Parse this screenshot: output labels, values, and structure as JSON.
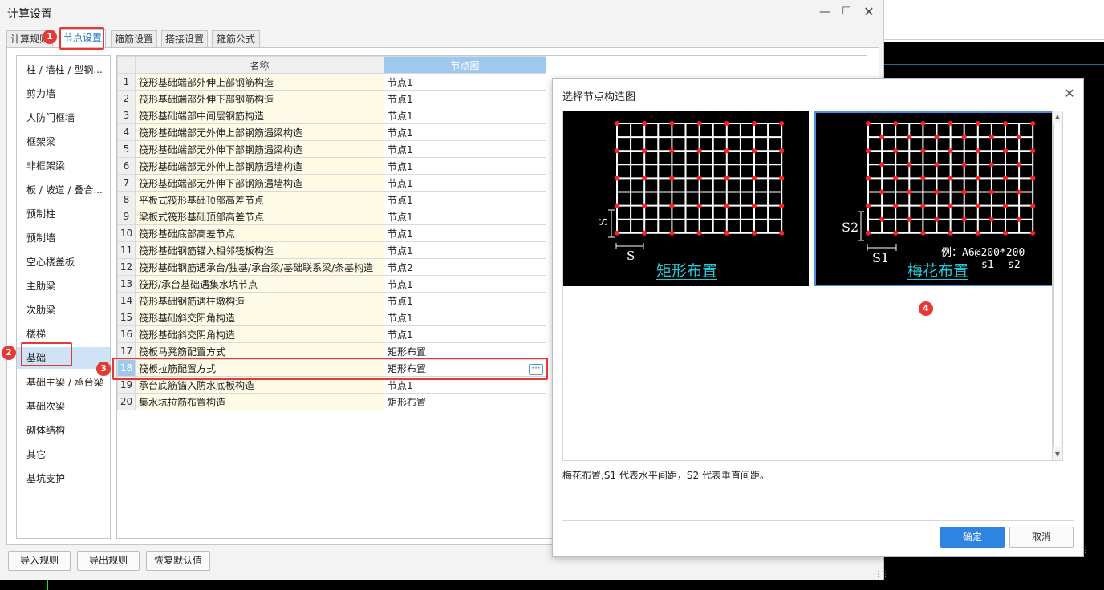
{
  "window": {
    "title": "计算设置"
  },
  "tabs": [
    {
      "label": "计算规则"
    },
    {
      "label": "节点设置"
    },
    {
      "label": "箍筋设置"
    },
    {
      "label": "搭接设置"
    },
    {
      "label": "箍筋公式"
    }
  ],
  "sidebar": {
    "items": [
      {
        "label": "柱 / 墙柱 / 型钢..."
      },
      {
        "label": "剪力墙"
      },
      {
        "label": "人防门框墙"
      },
      {
        "label": "框架梁"
      },
      {
        "label": "非框架梁"
      },
      {
        "label": "板 / 坡道 / 叠合..."
      },
      {
        "label": "预制柱"
      },
      {
        "label": "预制墙"
      },
      {
        "label": "空心楼盖板"
      },
      {
        "label": "主肋梁"
      },
      {
        "label": "次肋梁"
      },
      {
        "label": "楼梯"
      },
      {
        "label": "基础"
      },
      {
        "label": "基础主梁 / 承台梁"
      },
      {
        "label": "基础次梁"
      },
      {
        "label": "砌体结构"
      },
      {
        "label": "其它"
      },
      {
        "label": "基坑支护"
      }
    ]
  },
  "table": {
    "headers": {
      "name": "名称",
      "node": "节点图"
    },
    "rows": [
      {
        "num": "1",
        "name": "筏形基础端部外伸上部钢筋构造",
        "node": "节点1"
      },
      {
        "num": "2",
        "name": "筏形基础端部外伸下部钢筋构造",
        "node": "节点1"
      },
      {
        "num": "3",
        "name": "筏形基础端部中间层钢筋构造",
        "node": "节点1"
      },
      {
        "num": "4",
        "name": "筏形基础端部无外伸上部钢筋遇梁构造",
        "node": "节点1"
      },
      {
        "num": "5",
        "name": "筏形基础端部无外伸下部钢筋遇梁构造",
        "node": "节点1"
      },
      {
        "num": "6",
        "name": "筏形基础端部无外伸上部钢筋遇墙构造",
        "node": "节点1"
      },
      {
        "num": "7",
        "name": "筏形基础端部无外伸下部钢筋遇墙构造",
        "node": "节点1"
      },
      {
        "num": "8",
        "name": "平板式筏形基础顶部高差节点",
        "node": "节点1"
      },
      {
        "num": "9",
        "name": "梁板式筏形基础顶部高差节点",
        "node": "节点1"
      },
      {
        "num": "10",
        "name": "筏形基础底部高差节点",
        "node": "节点1"
      },
      {
        "num": "11",
        "name": "筏形基础钢筋锚入相邻筏板构造",
        "node": "节点1"
      },
      {
        "num": "12",
        "name": "筏形基础钢筋遇承台/独基/承台梁/基础联系梁/条基构造",
        "node": "节点2"
      },
      {
        "num": "13",
        "name": "筏形/承台基础遇集水坑节点",
        "node": "节点1"
      },
      {
        "num": "14",
        "name": "筏形基础钢筋遇柱墩构造",
        "node": "节点1"
      },
      {
        "num": "15",
        "name": "筏形基础斜交阳角构造",
        "node": "节点1"
      },
      {
        "num": "16",
        "name": "筏形基础斜交阴角构造",
        "node": "节点1"
      },
      {
        "num": "17",
        "name": "筏板马凳筋配置方式",
        "node": "矩形布置"
      },
      {
        "num": "18",
        "name": "筏板拉筋配置方式",
        "node": "矩形布置"
      },
      {
        "num": "19",
        "name": "承台底筋锚入防水底板构造",
        "node": "节点1"
      },
      {
        "num": "20",
        "name": "集水坑拉筋布置构造",
        "node": "矩形布置"
      }
    ]
  },
  "bottom_buttons": {
    "import": "导入规则",
    "export": "导出规则",
    "restore": "恢复默认值"
  },
  "dialog": {
    "title": "选择节点构造图",
    "options": [
      {
        "caption": "矩形布置",
        "label_v": "S",
        "label_h": "S"
      },
      {
        "caption": "梅花布置",
        "label_v": "S2",
        "label_h": "S1",
        "example": "例：A6@200*200",
        "sub1": "s1",
        "sub2": "s2"
      }
    ],
    "description": "梅花布置,S1 代表水平间距，S2 代表垂直间距。",
    "ok": "确定",
    "cancel": "取消"
  },
  "annotations": {
    "b1": "1",
    "b2": "2",
    "b3": "3",
    "b4": "4"
  },
  "colors": {
    "annotation": "#e53935",
    "accent": "#2e84e0",
    "caption": "#27c7d6",
    "rebar_point": "#ff2020"
  }
}
